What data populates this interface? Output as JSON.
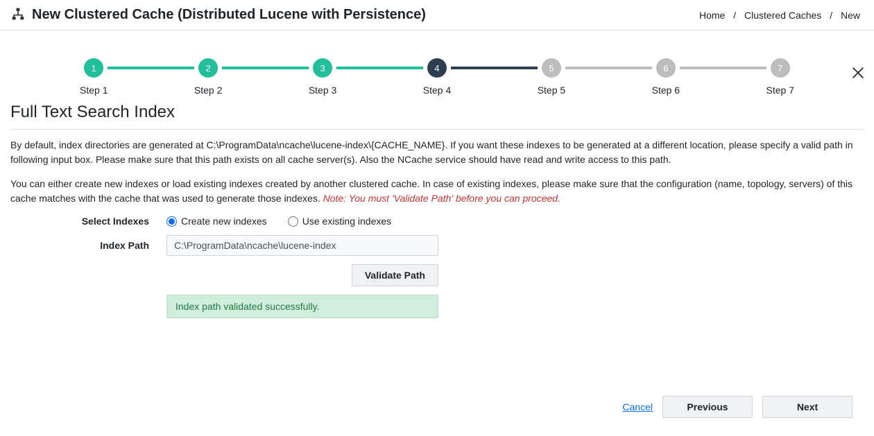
{
  "header": {
    "title": "New Clustered Cache (Distributed Lucene with Persistence)"
  },
  "breadcrumbs": [
    "Home",
    "Clustered Caches",
    "New"
  ],
  "stepper": {
    "steps": [
      {
        "num": "1",
        "label": "Step 1",
        "state": "complete"
      },
      {
        "num": "2",
        "label": "Step 2",
        "state": "complete"
      },
      {
        "num": "3",
        "label": "Step 3",
        "state": "complete"
      },
      {
        "num": "4",
        "label": "Step 4",
        "state": "active"
      },
      {
        "num": "5",
        "label": "Step 5",
        "state": "pending"
      },
      {
        "num": "6",
        "label": "Step 6",
        "state": "pending"
      },
      {
        "num": "7",
        "label": "Step 7",
        "state": "pending"
      }
    ]
  },
  "section_title": "Full Text Search Index",
  "description1": "By default, index directories are generated at C:\\ProgramData\\ncache\\lucene-index\\{CACHE_NAME}. If you want these indexes to be generated at a different location, please specify a valid path in following input box. Please make sure that this path exists on all cache server(s). Also the NCache service should have read and write access to this path.",
  "description2": "You can either create new indexes or load existing indexes created by another clustered cache. In case of existing indexes, please make sure that the configuration (name, topology, servers) of this cache matches with the cache that was used to generate those indexes. ",
  "note": "Note: You must 'Validate Path' before you can proceed.",
  "form": {
    "select_indexes_label": "Select Indexes",
    "radio_create": "Create new indexes",
    "radio_existing": "Use existing indexes",
    "index_path_label": "Index Path",
    "index_path_value": "C:\\ProgramData\\ncache\\lucene-index",
    "validate_btn": "Validate Path",
    "success_msg": "Index path validated successfully."
  },
  "footer": {
    "cancel": "Cancel",
    "previous": "Previous",
    "next": "Next"
  }
}
